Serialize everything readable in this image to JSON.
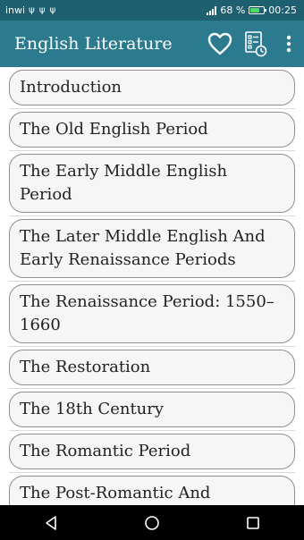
{
  "status_bar": {
    "carrier": "inwi",
    "usb_icons": "ψ ψ ψ",
    "battery_percent": "68 %",
    "battery_level": 0.68,
    "time": "00:25"
  },
  "app_bar": {
    "title": "English Literature",
    "icons": [
      "heart-outline-icon",
      "checklist-clock-icon",
      "more-vertical-icon"
    ]
  },
  "chapters": [
    "Introduction",
    "The Old English Period",
    "The Early Middle English Period",
    "The Later Middle English And Early Renaissance Periods",
    "The Renaissance Period: 1550–1660",
    "The Restoration",
    "The 18th Century",
    "The Romantic Period",
    "The Post-Romantic And Victorian Era"
  ],
  "nav_bar": {
    "icons": [
      "back-triangle-icon",
      "home-circle-icon",
      "recents-square-icon"
    ]
  },
  "colors": {
    "app_bar": "#2c7a8e",
    "status_bar": "#1e5f70",
    "item_border": "#8f8f8f",
    "item_bg": "#f6f6f6"
  }
}
